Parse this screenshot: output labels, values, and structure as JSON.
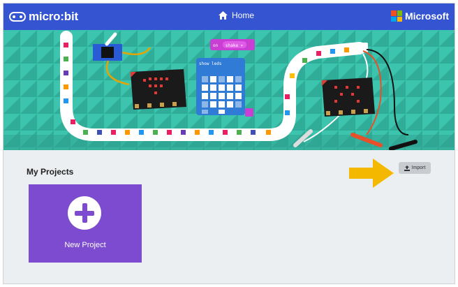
{
  "topbar": {
    "app_name": "micro:bit",
    "home_label": "Home",
    "brand_label": "Microsoft",
    "color": "#3454d1"
  },
  "banner": {
    "block_event_label": "on",
    "block_event_value": "shake ▾",
    "block_action_label": "show leds"
  },
  "main": {
    "section_title": "My Projects",
    "import_label": "Import",
    "new_project_label": "New Project",
    "card_color": "#7c4bd0",
    "arrow_color": "#f5b800"
  },
  "icons": [
    "microbit-logo-icon",
    "home-icon",
    "microsoft-logo-icon",
    "upload-icon",
    "plus-icon"
  ]
}
